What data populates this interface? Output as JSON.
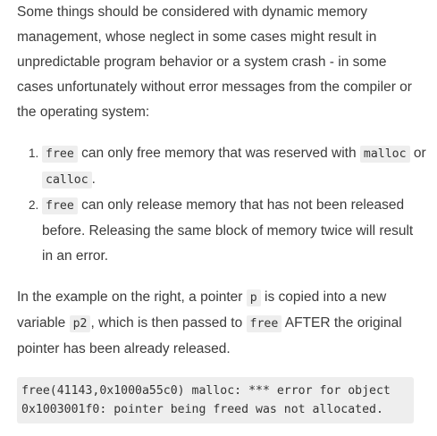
{
  "intro": "Some things should be considered with dynamic memory management, whose neglect in some cases might result in unpredictable program behavior or a system crash - in some cases unfortunately without error messages from the compiler or the operating system:",
  "rules": [
    {
      "code1": "free",
      "text1": " can only free memory that was reserved with ",
      "code2": "malloc",
      "text2": " or ",
      "code3": "calloc",
      "text3": "."
    },
    {
      "code1": "free",
      "text1": " can only release memory that has not been released before. Releasing the same block of memory twice will result in an error."
    }
  ],
  "example": {
    "text1": "In the example on the right, a pointer ",
    "code1": "p",
    "text2": " is copied into a new variable ",
    "code2": "p2",
    "text3": ", which is then passed to ",
    "code3": "free",
    "text4": " AFTER the original pointer has been already released."
  },
  "error_output": "free(41143,0x1000a55c0) malloc: *** error for object 0x1003001f0: pointer being freed was not allocated."
}
